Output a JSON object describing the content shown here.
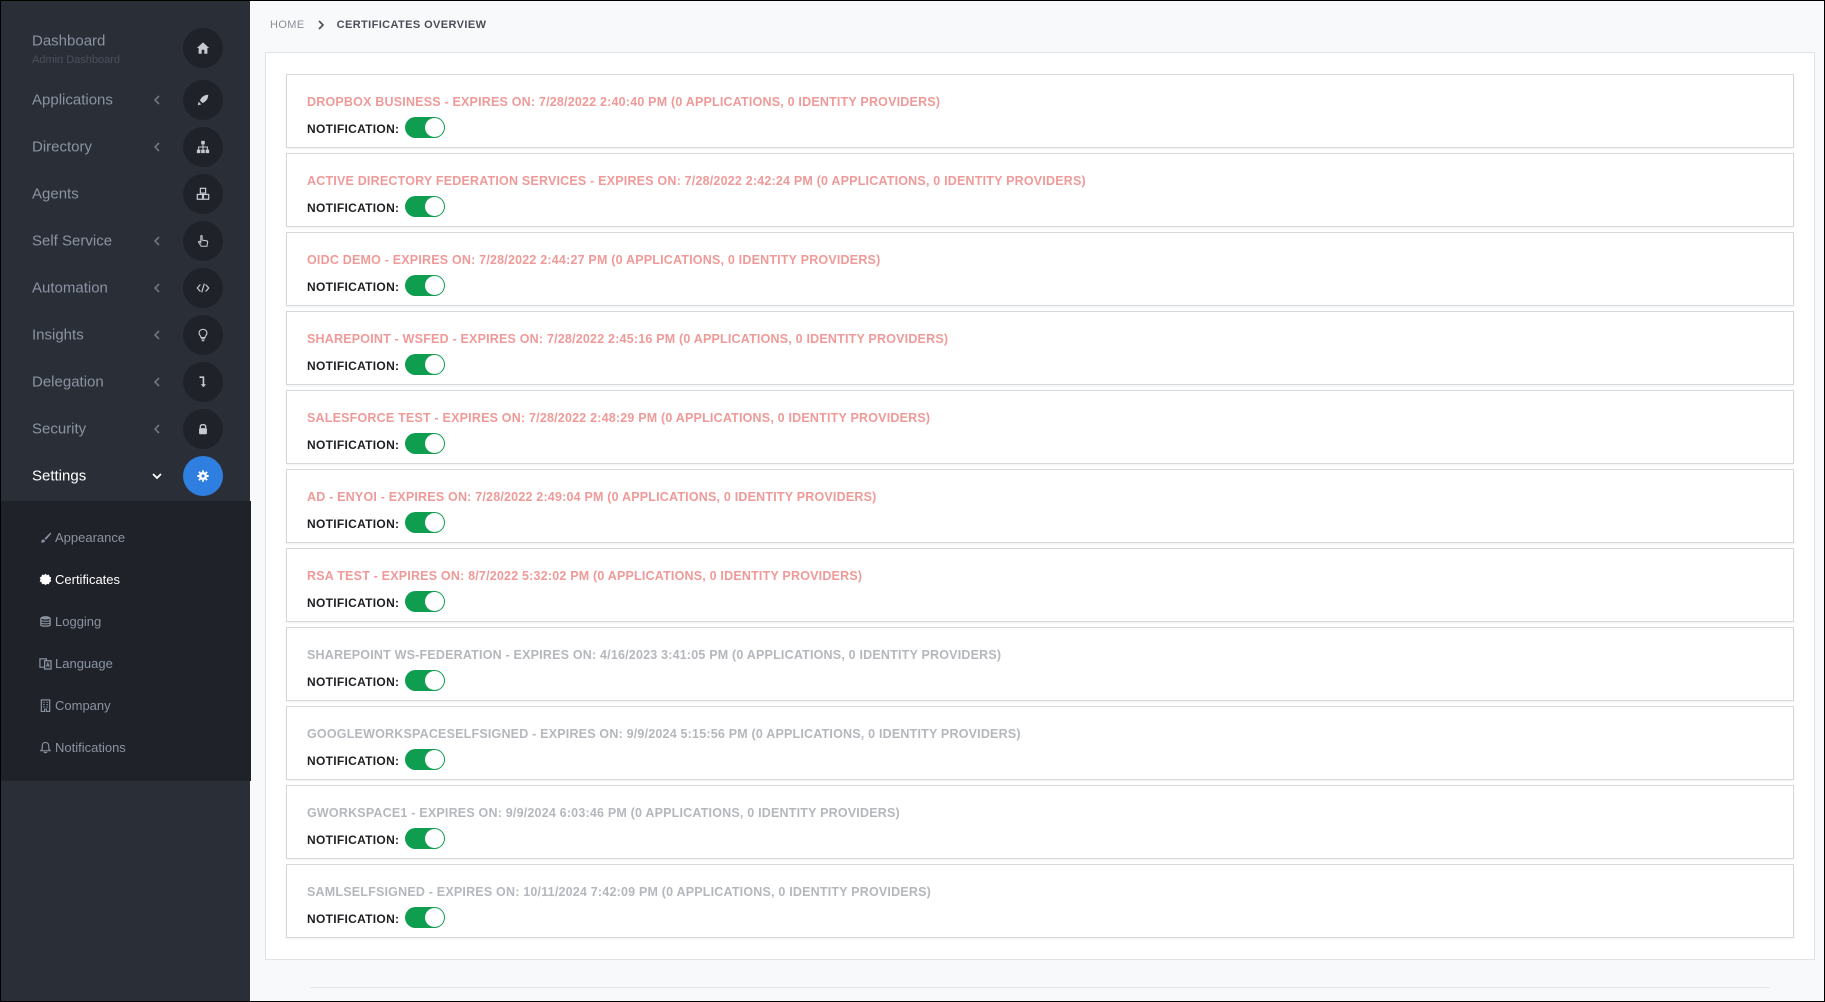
{
  "sidebar": {
    "items": [
      {
        "label": "Dashboard",
        "sub": "Admin Dashboard",
        "icon": "home-icon",
        "chevron": false
      },
      {
        "label": "Applications",
        "icon": "rocket-icon",
        "chevron": true
      },
      {
        "label": "Directory",
        "icon": "sitemap-icon",
        "chevron": true
      },
      {
        "label": "Agents",
        "icon": "cubes-icon",
        "chevron": false
      },
      {
        "label": "Self Service",
        "icon": "hand-pointer-icon",
        "chevron": true
      },
      {
        "label": "Automation",
        "icon": "code-icon",
        "chevron": true
      },
      {
        "label": "Insights",
        "icon": "lightbulb-icon",
        "chevron": true
      },
      {
        "label": "Delegation",
        "icon": "arrow-turn-icon",
        "chevron": true
      },
      {
        "label": "Security",
        "icon": "lock-icon",
        "chevron": true
      },
      {
        "label": "Settings",
        "icon": "gear-icon",
        "chevron": true,
        "active": true
      }
    ],
    "submenu": [
      {
        "label": "Appearance",
        "icon": "brush-icon"
      },
      {
        "label": "Certificates",
        "icon": "certificate-icon",
        "active": true
      },
      {
        "label": "Logging",
        "icon": "database-icon"
      },
      {
        "label": "Language",
        "icon": "language-icon"
      },
      {
        "label": "Company",
        "icon": "building-icon"
      },
      {
        "label": "Notifications",
        "icon": "bell-icon"
      }
    ]
  },
  "breadcrumb": {
    "home": "HOME",
    "current": "CERTIFICATES OVERVIEW"
  },
  "notification_label": "NOTIFICATION:",
  "certificates": [
    {
      "title": "DROPBOX BUSINESS - EXPIRES ON: 7/28/2022 2:40:40 PM (0 APPLICATIONS, 0 IDENTITY PROVIDERS)",
      "status": "expired",
      "notification": true
    },
    {
      "title": "ACTIVE DIRECTORY FEDERATION SERVICES - EXPIRES ON: 7/28/2022 2:42:24 PM (0 APPLICATIONS, 0 IDENTITY PROVIDERS)",
      "status": "expired",
      "notification": true
    },
    {
      "title": "OIDC DEMO - EXPIRES ON: 7/28/2022 2:44:27 PM (0 APPLICATIONS, 0 IDENTITY PROVIDERS)",
      "status": "expired",
      "notification": true
    },
    {
      "title": "SHAREPOINT - WSFED - EXPIRES ON: 7/28/2022 2:45:16 PM (0 APPLICATIONS, 0 IDENTITY PROVIDERS)",
      "status": "expired",
      "notification": true
    },
    {
      "title": "SALESFORCE TEST - EXPIRES ON: 7/28/2022 2:48:29 PM (0 APPLICATIONS, 0 IDENTITY PROVIDERS)",
      "status": "expired",
      "notification": true
    },
    {
      "title": "AD - ENYOI - EXPIRES ON: 7/28/2022 2:49:04 PM (0 APPLICATIONS, 0 IDENTITY PROVIDERS)",
      "status": "expired",
      "notification": true
    },
    {
      "title": "RSA TEST - EXPIRES ON: 8/7/2022 5:32:02 PM (0 APPLICATIONS, 0 IDENTITY PROVIDERS)",
      "status": "expired",
      "notification": true
    },
    {
      "title": "SHAREPOINT WS-FEDERATION - EXPIRES ON: 4/16/2023 3:41:05 PM (0 APPLICATIONS, 0 IDENTITY PROVIDERS)",
      "status": "valid",
      "notification": true
    },
    {
      "title": "GOOGLEWORKSPACESELFSIGNED - EXPIRES ON: 9/9/2024 5:15:56 PM (0 APPLICATIONS, 0 IDENTITY PROVIDERS)",
      "status": "valid",
      "notification": true
    },
    {
      "title": "GWORKSPACE1 - EXPIRES ON: 9/9/2024 6:03:46 PM (0 APPLICATIONS, 0 IDENTITY PROVIDERS)",
      "status": "valid",
      "notification": true
    },
    {
      "title": "SAMLSELFSIGNED - EXPIRES ON: 10/11/2024 7:42:09 PM (0 APPLICATIONS, 0 IDENTITY PROVIDERS)",
      "status": "valid",
      "notification": true
    }
  ],
  "colors": {
    "expired_title": "#ef9a98",
    "valid_title": "#b4b8bd",
    "toggle_on": "#0f9d4f",
    "settings_active": "#2f7fe0",
    "sidebar_bg": "#2a2e37"
  }
}
